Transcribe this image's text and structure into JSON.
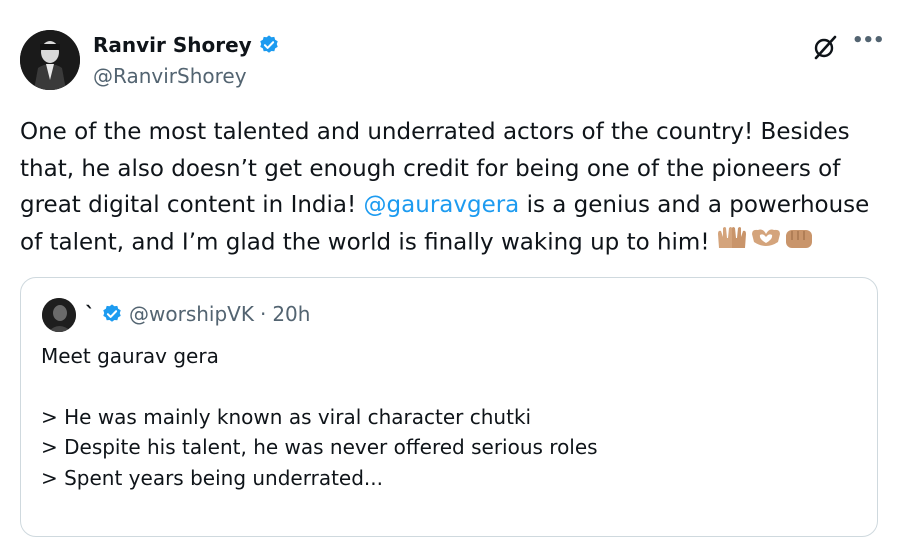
{
  "tweet": {
    "author": {
      "name": "Ranvir Shorey",
      "handle": "@RanvirShorey"
    },
    "text": {
      "line1": "One of the most talented and underrated actors of the country! Besides",
      "line2": "that, he also doesn’t get enough credit for being one of the pioneers of",
      "line3_before": "great digital content in India! ",
      "mention": "@gauravgera",
      "line3_after": " is a genius and a powerhouse",
      "line4": "of talent, and I’m glad the world is finally waking up to him!"
    },
    "emojis": [
      "raising-hands-emoji",
      "heart-hands-emoji",
      "oncoming-fist-emoji"
    ]
  },
  "quote": {
    "name": "`",
    "handle": "@worshipVK",
    "separator": "·",
    "time": "20h",
    "lines": {
      "l1": "Meet gaurav gera",
      "l2": "> He was mainly known as viral character chutki",
      "l3": "> Despite his talent, he was never offered serious roles",
      "l4": "> Spent years being underrated..."
    }
  },
  "colors": {
    "text": "#0f1419",
    "secondary": "#536471",
    "link": "#1d9bf0",
    "border": "#cfd9de",
    "verified": "#1d9bf0"
  },
  "icons": {
    "verified": "verified-badge-icon",
    "grok": "grok-icon",
    "more": "more-options-icon"
  }
}
